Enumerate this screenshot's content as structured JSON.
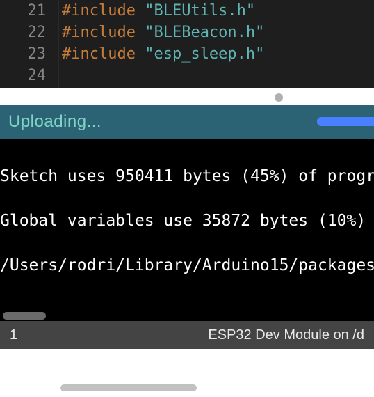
{
  "editor": {
    "lines": [
      {
        "num": "21",
        "directive": "#include ",
        "string": "\"BLEUtils.h\""
      },
      {
        "num": "22",
        "directive": "#include ",
        "string": "\"BLEBeacon.h\""
      },
      {
        "num": "23",
        "directive": "#include ",
        "string": "\"esp_sleep.h\""
      },
      {
        "num": "24",
        "directive": "",
        "string": ""
      }
    ]
  },
  "status": {
    "label": "Uploading..."
  },
  "console": {
    "lines": [
      "Sketch uses 950411 bytes (45%) of progr",
      "Global variables use 35872 bytes (10%) ",
      "/Users/rodri/Library/Arduino15/packages"
    ]
  },
  "footer": {
    "left": "1",
    "right": "ESP32 Dev Module on /d"
  }
}
